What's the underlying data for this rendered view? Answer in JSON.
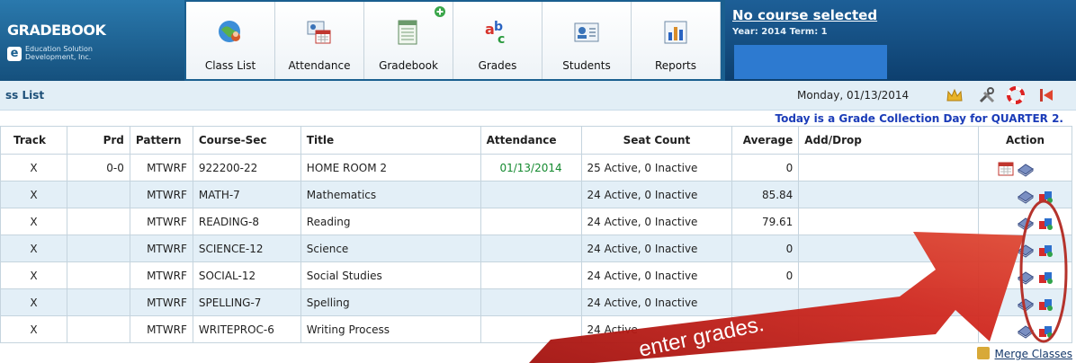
{
  "app": {
    "name": "GRADEBOOK",
    "logo_letter": "e",
    "company_line1": "Education Solution",
    "company_line2": "Development, Inc."
  },
  "nav": {
    "tabs": [
      "Class List",
      "Attendance",
      "Gradebook",
      "Grades",
      "Students",
      "Reports"
    ]
  },
  "course": {
    "status": "No course selected",
    "term": "Year: 2014 Term: 1"
  },
  "subbar": {
    "breadcrumb": "ss List",
    "date": "Monday, 01/13/2014"
  },
  "notice": "Today is a Grade Collection Day for QUARTER 2.",
  "table": {
    "columns": [
      "Track",
      "Prd",
      "Pattern",
      "Course-Sec",
      "Title",
      "Attendance",
      "Seat Count",
      "Average",
      "Add/Drop",
      "Action"
    ],
    "rows": [
      {
        "track": "X",
        "prd": "0-0",
        "pattern": "MTWRF",
        "course": "922200-22",
        "title": "HOME ROOM 2",
        "attendance": "01/13/2014",
        "seats": "25 Active, 0 Inactive",
        "average": "0",
        "adddrop": ""
      },
      {
        "track": "X",
        "prd": "",
        "pattern": "MTWRF",
        "course": "MATH-7",
        "title": "Mathematics",
        "attendance": "",
        "seats": "24 Active, 0 Inactive",
        "average": "85.84",
        "adddrop": ""
      },
      {
        "track": "X",
        "prd": "",
        "pattern": "MTWRF",
        "course": "READING-8",
        "title": "Reading",
        "attendance": "",
        "seats": "24 Active, 0 Inactive",
        "average": "79.61",
        "adddrop": ""
      },
      {
        "track": "X",
        "prd": "",
        "pattern": "MTWRF",
        "course": "SCIENCE-12",
        "title": "Science",
        "attendance": "",
        "seats": "24 Active, 0 Inactive",
        "average": "0",
        "adddrop": ""
      },
      {
        "track": "X",
        "prd": "",
        "pattern": "MTWRF",
        "course": "SOCIAL-12",
        "title": "Social Studies",
        "attendance": "",
        "seats": "24 Active, 0 Inactive",
        "average": "0",
        "adddrop": ""
      },
      {
        "track": "X",
        "prd": "",
        "pattern": "MTWRF",
        "course": "SPELLING-7",
        "title": "Spelling",
        "attendance": "",
        "seats": "24 Active, 0 Inactive",
        "average": "",
        "adddrop": ""
      },
      {
        "track": "X",
        "prd": "",
        "pattern": "MTWRF",
        "course": "WRITEPROC-6",
        "title": "Writing Process",
        "attendance": "",
        "seats": "24 Active",
        "average": "",
        "adddrop": ""
      }
    ]
  },
  "merge_label": "Merge Classes",
  "annotation": {
    "text": "enter grades."
  },
  "colors": {
    "header_blue": "#1a5f8f",
    "row_alt": "#e3eff7",
    "arrow_red": "#c7211b",
    "notice_blue": "#1b3cb8"
  }
}
